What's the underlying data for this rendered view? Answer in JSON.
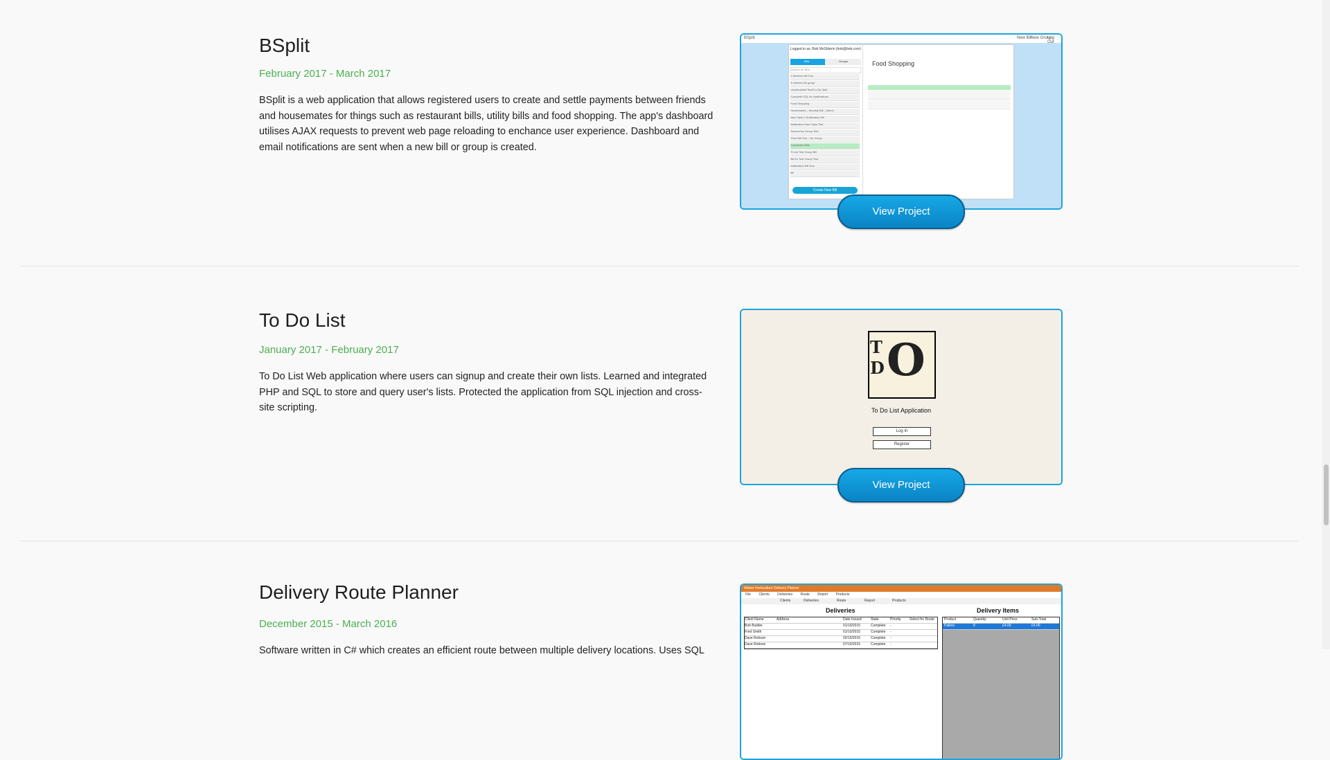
{
  "projects": [
    {
      "title": "BSplit",
      "date": "February 2017 - March 2017",
      "description": "BSplit is a web application that allows registered users to create and settle payments between friends and housemates for things such as restaurant bills, utility bills and food shopping. The app's dashboard utilises AJAX requests to prevent web page reloading to enchance user experience. Dashboard and email notifications are sent when a new bill or group is created.",
      "button": "View Project",
      "screenshot": {
        "brand": "BSplit",
        "nav": [
          "New Bill",
          "New Group",
          "Log Out"
        ],
        "logged_in": "Logged in as: Bob McGlderin (bob@bob.com)",
        "tabs": [
          "Bills",
          "Groups"
        ],
        "search_placeholder": "Search for Bills",
        "bill_list": [
          "2 Member Bill Test",
          "3 member bill group",
          "Uncalculated Test/Co-Op Split",
          "Complete SQL for Notifications",
          "Food Shopping",
          "Housemates – Monthly Bill – March",
          "New Style 2 Notification Bill",
          "Notification New Style Test",
          "Second No Group Test",
          "Third Bill Test – No Group",
          "Completed Bills",
          "Tri est Test Group Bill",
          "Bill for Test Group Test",
          "Notification Bill Test",
          "BP"
        ],
        "create_button": "Create New Bill",
        "bill_title": "Food Shopping",
        "table_headers": [
          "Settled Friend",
          "Amount To Pay",
          "Amount Paid",
          "Date Payed",
          "$"
        ]
      }
    },
    {
      "title": "To Do List",
      "date": "January 2017 - February 2017",
      "description": "To Do List Web application where users can signup and create their own lists. Learned and integrated PHP and SQL to store and query user's lists. Protected the application from SQL injection and cross-site scripting.",
      "button": "View Project",
      "screenshot": {
        "logo_letters": [
          "T",
          "D",
          "O"
        ],
        "caption": "To Do List Application",
        "buttons": [
          "Log In",
          "Register"
        ]
      }
    },
    {
      "title": "Delivery Route Planner",
      "date": "December 2015 - March 2016",
      "description": "Software written in C# which creates an efficient route between multiple delivery locations. Uses SQL",
      "screenshot": {
        "window_title": "Weber Horticulture Delivery Planner",
        "menu": [
          "File",
          "Clients",
          "Deliveries",
          "Route",
          "Report",
          "Products"
        ],
        "tabs": [
          "Clients",
          "Deliveries",
          "Route",
          "Report",
          "Products"
        ],
        "deliveries_heading": "Deliveries",
        "items_heading": "Delivery Items",
        "deliveries_headers": [
          "Client Name",
          "Address",
          "Date Issued",
          "State",
          "Priority",
          "Select for Route"
        ],
        "deliveries_rows": [
          [
            "Bob Builder",
            "",
            "01/10/2015",
            "Complete",
            "-"
          ],
          [
            "Fred Smith",
            "",
            "01/10/2015",
            "Complete",
            "-"
          ],
          [
            "Dave Robson",
            "",
            "02/10/2015",
            "Complete",
            "-"
          ],
          [
            "Dave Robson",
            "",
            "07/10/2015",
            "Complete",
            "-"
          ]
        ],
        "items_headers": [
          "Product",
          "Quantity",
          "Unit Price",
          "Sub-Total"
        ],
        "items_rows": [
          [
            "Pallets",
            "8",
            "£4.00",
            "£4.00"
          ]
        ]
      }
    }
  ]
}
